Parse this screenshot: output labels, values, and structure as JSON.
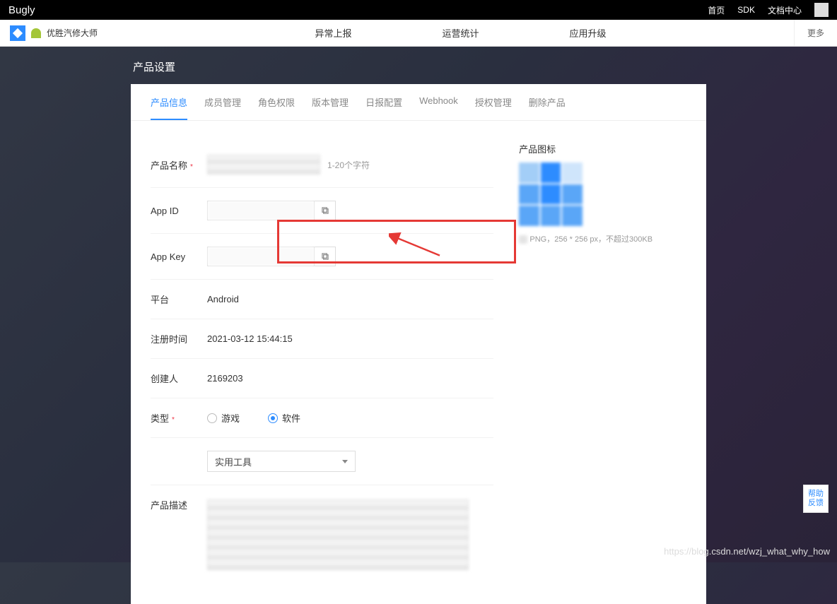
{
  "topbar": {
    "logo": "Bugly",
    "links": [
      "首页",
      "SDK",
      "文档中心"
    ]
  },
  "navbar": {
    "app_name": "优胜汽修大师",
    "items": [
      "异常上报",
      "运营统计",
      "应用升级"
    ],
    "more": "更多"
  },
  "page_title": "产品设置",
  "tabs": [
    "产品信息",
    "成员管理",
    "角色权限",
    "版本管理",
    "日报配置",
    "Webhook",
    "授权管理",
    "删除产品"
  ],
  "active_tab": 0,
  "form": {
    "product_name": {
      "label": "产品名称",
      "value": "",
      "hint": "1-20个字符"
    },
    "app_id": {
      "label": "App ID",
      "value": ""
    },
    "app_key": {
      "label": "App Key",
      "value": ""
    },
    "platform": {
      "label": "平台",
      "value": "Android"
    },
    "register_time": {
      "label": "注册时间",
      "value": "2021-03-12 15:44:15"
    },
    "creator": {
      "label": "创建人",
      "value": "2169203"
    },
    "type": {
      "label": "类型",
      "options": [
        "游戏",
        "软件"
      ],
      "selected": "软件"
    },
    "category": {
      "label": "",
      "value": "实用工具"
    },
    "description": {
      "label": "产品描述",
      "value": ""
    }
  },
  "icon_section": {
    "title": "产品图标",
    "hint": "PNG，256 * 256 px，不超过300KB"
  },
  "help_float": "帮助\n反馈",
  "watermark": "https://blog.csdn.net/wzj_what_why_how"
}
